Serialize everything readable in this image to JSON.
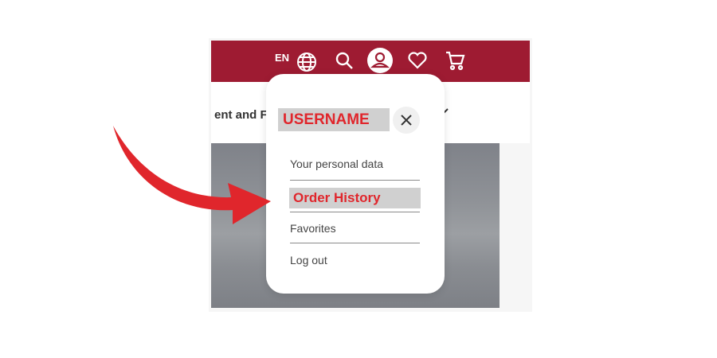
{
  "header": {
    "language_code": "EN",
    "icons": [
      "globe-icon",
      "search-icon",
      "user-icon",
      "heart-icon",
      "cart-icon"
    ],
    "background_color": "#9e1b32"
  },
  "nav": {
    "partial_text": "ent and F"
  },
  "account_menu": {
    "username": "USERNAME",
    "items": [
      {
        "label": "Your personal data"
      },
      {
        "label": "Order History",
        "highlighted": true
      },
      {
        "label": "Favorites"
      },
      {
        "label": "Log out"
      }
    ],
    "highlight_color": "#e0262c"
  },
  "annotation": {
    "arrow_color": "#e0262c",
    "points_to": "Order History"
  }
}
